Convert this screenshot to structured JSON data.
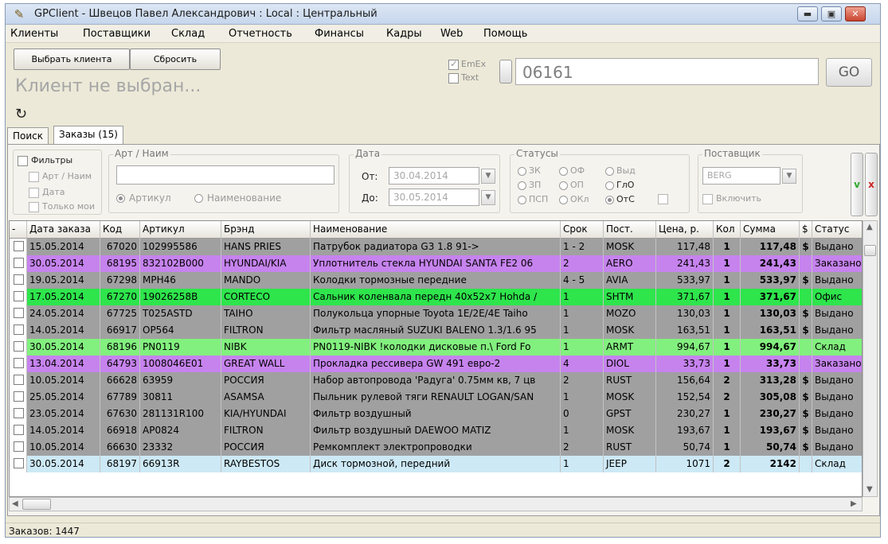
{
  "window": {
    "title": "GPClient - Швецов Павел Александрович : Local : Центральный",
    "min_label": "▬",
    "max_label": "▣",
    "close_label": "✕"
  },
  "menu": [
    "Клиенты",
    "Поставщики",
    "Склад",
    "Отчетность",
    "Финансы",
    "Кадры",
    "Web",
    "Помощь"
  ],
  "toolbar": {
    "select_client": "Выбрать клиента",
    "reset": "Сбросить",
    "client_status": "Клиент не выбран...",
    "emex_label": "EmEx",
    "text_label": "Text",
    "search_value": "06161",
    "go_label": "GO",
    "refresh_icon": "↻"
  },
  "tabs": [
    "Поиск",
    "Заказы (15)"
  ],
  "filters": {
    "filters_label": "Фильтры",
    "art_name_label": "Арт / Наим",
    "date_label": "Дата",
    "only_mine_label": "Только мои",
    "art_group_title": "Арт / Наим",
    "article_radio": "Артикул",
    "name_radio": "Наименование",
    "date_group_title": "Дата",
    "from_label": "От:",
    "from_value": "30.04.2014",
    "to_label": "До:",
    "to_value": "30.05.2014",
    "status_group_title": "Статусы",
    "statuses": [
      "ЗК",
      "ОФ",
      "Выд",
      "ЗП",
      "ОП",
      "ГлО",
      "ПСП",
      "ОКл",
      "ОтС"
    ],
    "supplier_group_title": "Поставщик",
    "supplier_value": "BERG",
    "include_label": "Включить",
    "accept_label": "v",
    "cancel_label": "x"
  },
  "grid": {
    "headers": [
      "-",
      "Дата заказа",
      "Код",
      "Артикул",
      "Брэнд",
      "Наименование",
      "Срок",
      "Пост.",
      "Цена, р.",
      "Кол",
      "Сумма",
      "$",
      "Статус"
    ],
    "rows": [
      {
        "date": "15.05.2014",
        "code": "67020",
        "article": "102995586",
        "brand": "HANS PRIES",
        "name": "Патрубок радиатора G3 1.8 91->",
        "term": "1 - 2",
        "supplier": "MOSK",
        "price": "117,48",
        "qty": "1",
        "sum": "117,48",
        "dollar": "$",
        "status": "Выдано",
        "color": "gray"
      },
      {
        "date": "30.05.2014",
        "code": "68195",
        "article": "832102B000",
        "brand": "HYUNDAI/KIA",
        "name": "Уплотнитель стекла HYUNDAI SANTA FE2 06",
        "term": "2",
        "supplier": "AERO",
        "price": "241,43",
        "qty": "1",
        "sum": "241,43",
        "dollar": "",
        "status": "Заказано",
        "color": "purple"
      },
      {
        "date": "19.05.2014",
        "code": "67298",
        "article": "MPH46",
        "brand": "MANDO",
        "name": "Колодки тормозные передние",
        "term": "4 - 5",
        "supplier": "AVIA",
        "price": "533,97",
        "qty": "1",
        "sum": "533,97",
        "dollar": "$",
        "status": "Выдано",
        "color": "gray"
      },
      {
        "date": "17.05.2014",
        "code": "67270",
        "article": "19026258B",
        "brand": "CORTECO",
        "name": "Сальник коленвала передн 40x52x7 Hohda /",
        "term": "1",
        "supplier": "SHTM",
        "price": "371,67",
        "qty": "1",
        "sum": "371,67",
        "dollar": "",
        "status": "Офис",
        "color": "green"
      },
      {
        "date": "24.05.2014",
        "code": "67725",
        "article": "T025ASTD",
        "brand": "TAIHO",
        "name": "Полукольца упорные Toyota 1E/2E/4E Taiho",
        "term": "1",
        "supplier": "MOZO",
        "price": "130,03",
        "qty": "1",
        "sum": "130,03",
        "dollar": "$",
        "status": "Выдано",
        "color": "gray"
      },
      {
        "date": "14.05.2014",
        "code": "66917",
        "article": "OP564",
        "brand": "FILTRON",
        "name": "Фильтр масляный SUZUKI BALENO 1.3/1.6 95",
        "term": "1",
        "supplier": "MOSK",
        "price": "163,51",
        "qty": "1",
        "sum": "163,51",
        "dollar": "$",
        "status": "Выдано",
        "color": "gray"
      },
      {
        "date": "30.05.2014",
        "code": "68196",
        "article": "PN0119",
        "brand": "NIBK",
        "name": "PN0119-NIBK !колодки дисковые п.\\ Ford Fo",
        "term": "1",
        "supplier": "ARMT",
        "price": "994,67",
        "qty": "1",
        "sum": "994,67",
        "dollar": "",
        "status": "Склад",
        "color": "lgreen"
      },
      {
        "date": "13.04.2014",
        "code": "64793",
        "article": "1008046E01",
        "brand": "GREAT WALL",
        "name": "Прокладка рессивера GW 491 евро-2",
        "term": "4",
        "supplier": "DIOL",
        "price": "33,73",
        "qty": "1",
        "sum": "33,73",
        "dollar": "",
        "status": "Заказано",
        "color": "purple"
      },
      {
        "date": "10.05.2014",
        "code": "66628",
        "article": "63959",
        "brand": "РОССИЯ",
        "name": "Набор автопровода 'Радуга' 0.75мм кв, 7 цв",
        "term": "2",
        "supplier": "RUST",
        "price": "156,64",
        "qty": "2",
        "sum": "313,28",
        "dollar": "$",
        "status": "Выдано",
        "color": "gray"
      },
      {
        "date": "25.05.2014",
        "code": "67789",
        "article": "30811",
        "brand": "ASAMSA",
        "name": "Пыльник рулевой тяги RENAULT LOGAN/SAN",
        "term": "1",
        "supplier": "MOSK",
        "price": "152,54",
        "qty": "2",
        "sum": "305,08",
        "dollar": "$",
        "status": "Выдано",
        "color": "gray"
      },
      {
        "date": "23.05.2014",
        "code": "67630",
        "article": "281131R100",
        "brand": "KIA/HYUNDAI",
        "name": "Фильтр воздушный",
        "term": "0",
        "supplier": "GPST",
        "price": "230,27",
        "qty": "1",
        "sum": "230,27",
        "dollar": "$",
        "status": "Выдано",
        "color": "gray"
      },
      {
        "date": "14.05.2014",
        "code": "66918",
        "article": "AP0824",
        "brand": "FILTRON",
        "name": "Фильтр воздушный DAEWOO MATIZ",
        "term": "1",
        "supplier": "MOSK",
        "price": "193,67",
        "qty": "1",
        "sum": "193,67",
        "dollar": "$",
        "status": "Выдано",
        "color": "gray"
      },
      {
        "date": "10.05.2014",
        "code": "66630",
        "article": "23332",
        "brand": "РОССИЯ",
        "name": "Ремкомплект электропроводки",
        "term": "2",
        "supplier": "RUST",
        "price": "50,74",
        "qty": "1",
        "sum": "50,74",
        "dollar": "$",
        "status": "Выдано",
        "color": "gray"
      },
      {
        "date": "30.05.2014",
        "code": "68197",
        "article": "66913R",
        "brand": "RAYBESTOS",
        "name": "Диск тормозной, передний",
        "term": "1",
        "supplier": "JEEP",
        "price": "1071",
        "qty": "2",
        "sum": "2142",
        "dollar": "",
        "status": "Склад",
        "color": "lblue"
      }
    ]
  },
  "status_bar": "Заказов: 1447",
  "colors": {
    "gray": "#a0a0a0",
    "purple": "#c683ee",
    "green": "#2ee54c",
    "lgreen": "#82f07e",
    "lblue": "#cde9f6",
    "accept": "#2eaa2e",
    "cancel": "#cc2222"
  }
}
